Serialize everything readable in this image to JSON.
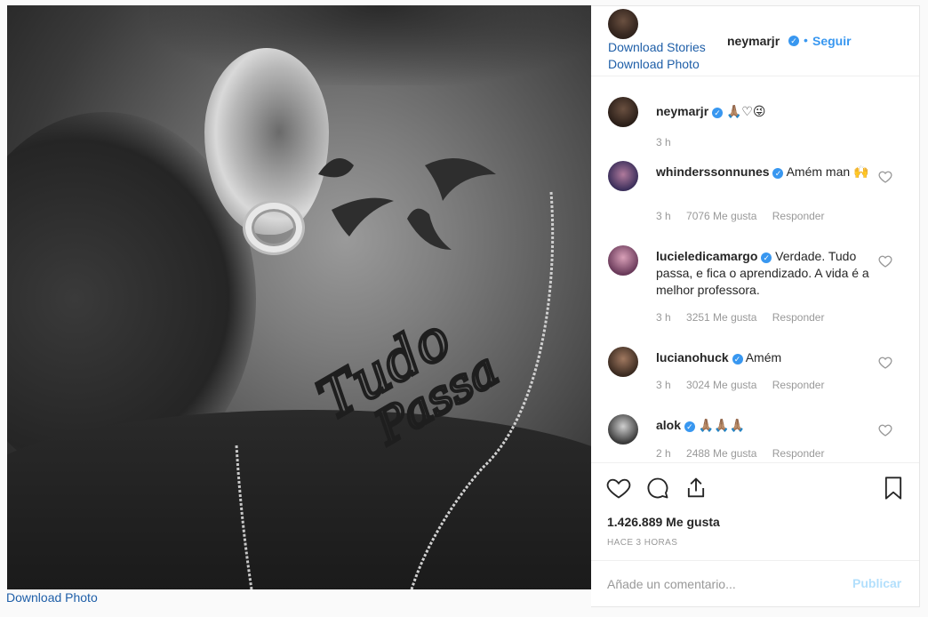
{
  "post": {
    "image_alt": "Black and white close-up of neck tattoo with birds and the words Tudo Passa",
    "download_photo_label": "Download Photo"
  },
  "header": {
    "username": "neymarjr",
    "verified_icon": "verified-badge-icon",
    "separator": "•",
    "follow_label": "Seguir",
    "download_stories_label": "Download Stories",
    "download_photo_label": "Download Photo"
  },
  "comments": [
    {
      "username": "neymarjr",
      "text": "🙏🏽♡😜",
      "time": "3 h",
      "likes": "",
      "reply": ""
    },
    {
      "username": "whinderssonnunes",
      "text": "Amém man 🙌",
      "time": "3 h",
      "likes": "7076 Me gusta",
      "reply": "Responder"
    },
    {
      "username": "lucieledicamargo",
      "text": "Verdade. Tudo passa, e fica o aprendizado. A vida é a melhor professora.",
      "time": "3 h",
      "likes": "3251 Me gusta",
      "reply": "Responder"
    },
    {
      "username": "lucianohuck",
      "text": "Amém",
      "time": "3 h",
      "likes": "3024 Me gusta",
      "reply": "Responder"
    },
    {
      "username": "alok",
      "text": "🙏🏽🙏🏽🙏🏽",
      "time": "2 h",
      "likes": "2488 Me gusta",
      "reply": "Responder"
    }
  ],
  "actions": {
    "like_icon": "heart-icon",
    "comment_icon": "comment-bubble-icon",
    "share_icon": "share-icon",
    "save_icon": "bookmark-icon",
    "likes_count": "1.426.889 Me gusta",
    "timestamp": "HACE 3 HORAS"
  },
  "add_comment": {
    "placeholder": "Añade un comentario...",
    "post_label": "Publicar"
  },
  "colors": {
    "link": "#1f5fa8",
    "accent": "#3897f0",
    "post_disabled": "#b2dffc",
    "meta": "#999999"
  }
}
